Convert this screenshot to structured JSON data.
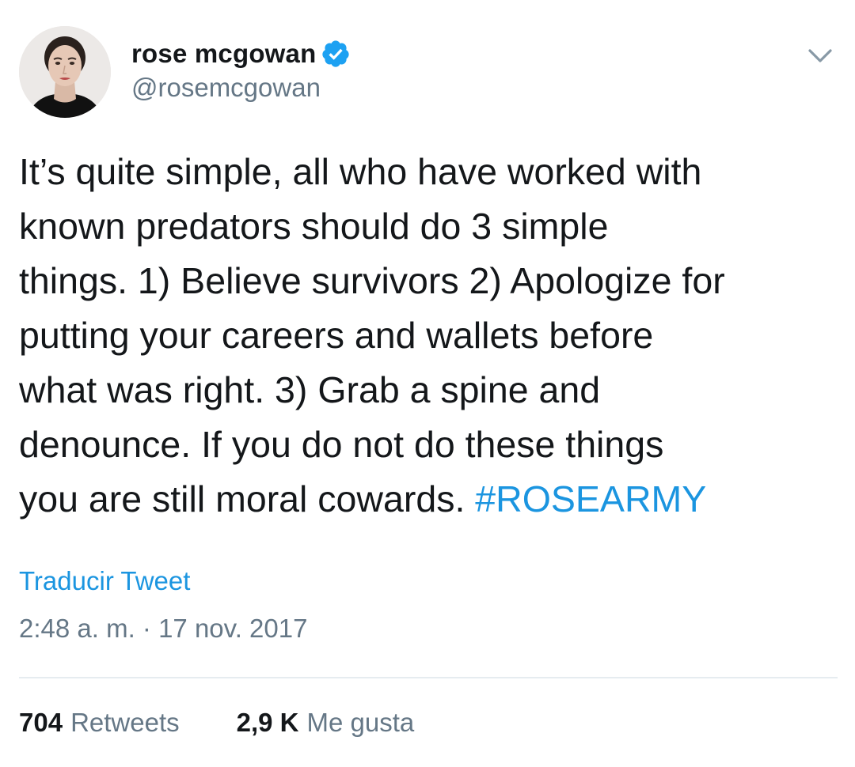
{
  "tweet": {
    "author": {
      "name": "rose mcgowan",
      "handle": "@rosemcgowan",
      "verified": true
    },
    "text_lines": [
      "It’s quite simple, all who have worked with",
      "known predators should do 3 simple",
      "things. 1) Believe survivors 2) Apologize for",
      "putting your careers and wallets before",
      "what was right. 3) Grab a spine and",
      "denounce. If you do not do these things",
      "you are still moral cowards. "
    ],
    "hashtag": "#ROSEARMY",
    "translate_label": "Traducir Tweet",
    "timestamp": "2:48 a. m. · 17 nov. 2017",
    "stats": {
      "retweets_count": "704",
      "retweets_label": "Retweets",
      "likes_count": "2,9 K",
      "likes_label": "Me gusta"
    }
  },
  "colors": {
    "link": "#1b95e0",
    "muted": "#657786",
    "text": "#14171a",
    "divider": "#e6ecf0",
    "verified": "#1da1f2"
  },
  "icons": {
    "verified": "verified-badge-icon",
    "menu": "chevron-down-icon"
  }
}
